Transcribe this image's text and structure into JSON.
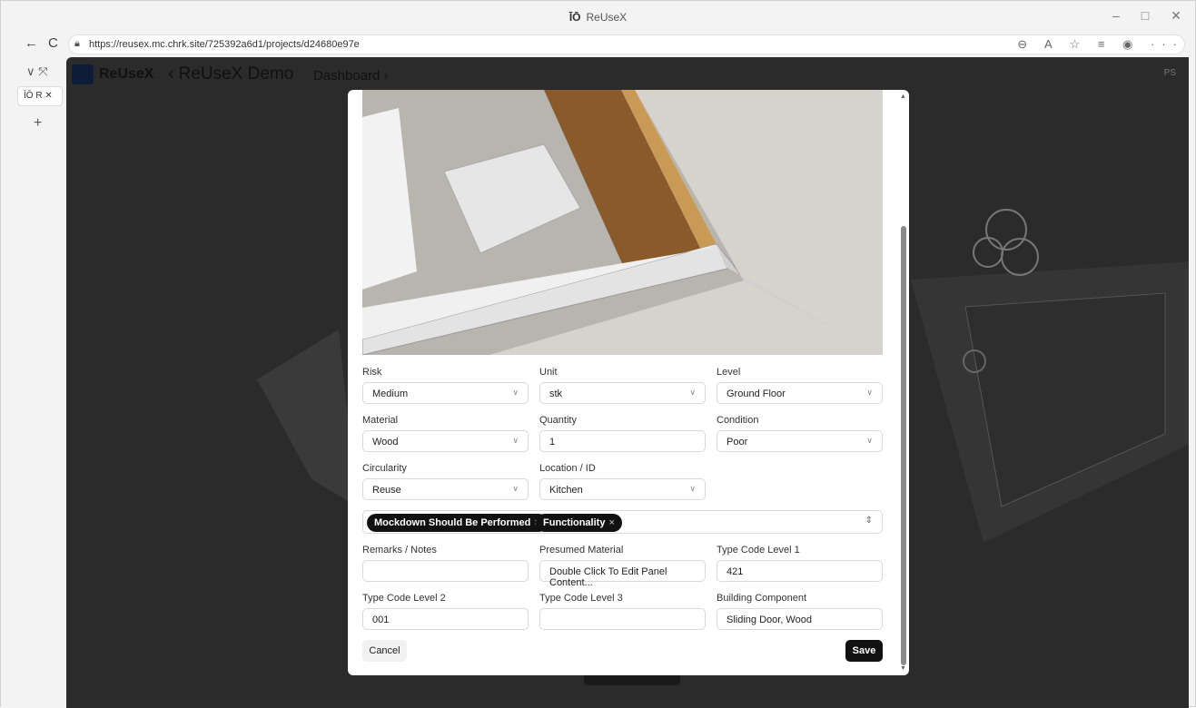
{
  "window": {
    "title": "ReUseX",
    "logo": "ĪŌ",
    "minimize": "–",
    "maximize": "□",
    "close": "✕"
  },
  "browser": {
    "url": "https://reusex.mc.chrk.site/725392a6d1/projects/d24680e97e",
    "back": "←",
    "refresh": "C",
    "right_icons": "⊖ A ☆ ≡ ◉ ···"
  },
  "sidebar": {
    "tab_label": "ĪŌ R ✕",
    "plus": "+",
    "top_icons": "∨ ⤧"
  },
  "app": {
    "name": "ReUseX",
    "project": "‹ ReUseX Demo",
    "dashboard": "Dashboard ›",
    "user_initials": "PS"
  },
  "form": {
    "risk": {
      "label": "Risk",
      "value": "Medium"
    },
    "unit": {
      "label": "Unit",
      "value": "stk"
    },
    "level": {
      "label": "Level",
      "value": "Ground Floor"
    },
    "material": {
      "label": "Material",
      "value": "Wood"
    },
    "quantity": {
      "label": "Quantity",
      "value": "1"
    },
    "condition": {
      "label": "Condition",
      "value": "Poor"
    },
    "circularity": {
      "label": "Circularity",
      "value": "Reuse"
    },
    "location": {
      "label": "Location / ID",
      "value": "Kitchen"
    },
    "tags": [
      {
        "label": "Mockdown Should Be Performed",
        "remove": "×"
      },
      {
        "label": "Functionality",
        "remove": "×"
      }
    ],
    "remarks": {
      "label": "Remarks / Notes",
      "value": ""
    },
    "presumed_material": {
      "label": "Presumed Material",
      "value": "Double Click To Edit Panel Content..."
    },
    "type_code_1": {
      "label": "Type Code Level 1",
      "value": "421"
    },
    "type_code_2": {
      "label": "Type Code Level 2",
      "value": "001"
    },
    "type_code_3": {
      "label": "Type Code Level 3",
      "value": ""
    },
    "building_component": {
      "label": "Building Component",
      "value": "Sliding Door, Wood"
    },
    "cancel": "Cancel",
    "save": "Save"
  }
}
